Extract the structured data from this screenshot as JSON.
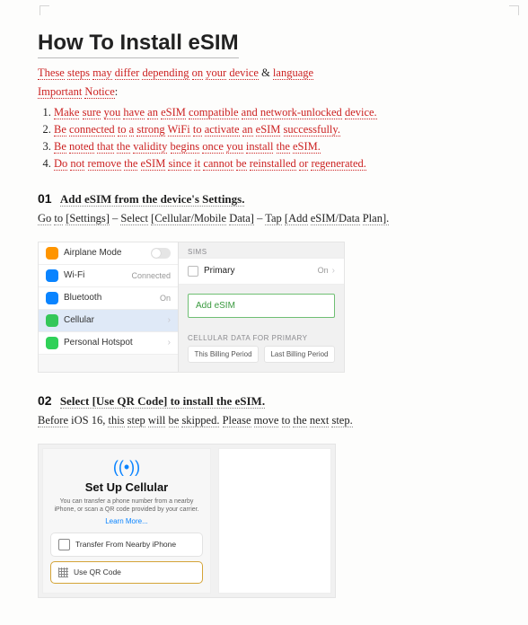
{
  "title": "How To Install eSIM",
  "intro_parts": {
    "p1": "These",
    "p2": "steps",
    "p3": "may",
    "p4": "differ",
    "p5": "depending",
    "p6": "on",
    "p7": "your",
    "p8": "device",
    "amp": "&",
    "p9": "language"
  },
  "important": {
    "label1": "Important",
    "label2": "Notice",
    "colon": ":"
  },
  "notice_items": [
    {
      "w": [
        "Make",
        "sure",
        "you",
        "have",
        "an",
        "eSIM",
        "compatible",
        "and",
        "network-unlocked",
        "device."
      ]
    },
    {
      "w": [
        "Be",
        "connected",
        "to",
        "a",
        "strong",
        "WiFi",
        "to",
        "activate",
        "an",
        "eSIM",
        "successfully."
      ]
    },
    {
      "w": [
        "Be",
        "noted",
        "that",
        "the",
        "validity",
        "begins",
        "once",
        "you",
        "install",
        "the",
        "eSIM."
      ]
    },
    {
      "w": [
        "Do",
        "not",
        "remove",
        "the",
        "eSIM",
        "since",
        "it",
        "cannot",
        "be",
        "reinstalled",
        "or",
        "regenerated."
      ]
    }
  ],
  "step1": {
    "num": "01",
    "title_words": [
      "Add",
      "eSIM",
      "from",
      "the",
      "device's",
      "Settings."
    ],
    "instr": {
      "go": "Go",
      "to": "to",
      "settings": "[Settings]",
      "dash": "–",
      "select": "Select",
      "cell": "[Cellular/Mobile",
      "data": "Data]",
      "tap": "Tap",
      "addplan": "[Add",
      "esim": "eSIM/Data",
      "plan": "Plan]."
    }
  },
  "settings_rows": {
    "airplane": "Airplane Mode",
    "wifi": "Wi-Fi",
    "wifi_val": "Connected",
    "bluetooth": "Bluetooth",
    "bt_val": "On",
    "cellular": "Cellular",
    "hotspot": "Personal Hotspot"
  },
  "sims_panel": {
    "sims_label": "SIMs",
    "primary": "Primary",
    "primary_on": "On",
    "add_esim": "Add eSIM",
    "cd_label": "CELLULAR DATA FOR PRIMARY",
    "tab1": "This Billing Period",
    "tab2": "Last Billing Period"
  },
  "step2": {
    "num": "02",
    "title_words": [
      "Select",
      "[Use",
      "QR",
      "Code]",
      "to",
      "install",
      "the",
      "eSIM."
    ],
    "instr": {
      "before": "Before",
      "ios": "iOS 16,",
      "this": "this",
      "step": "step",
      "will": "will",
      "be": "be",
      "skipped": "skipped.",
      "please": "Please",
      "move": "move",
      "to": "to",
      "the": "the",
      "next": "next",
      "nstep": "step."
    }
  },
  "setup_card": {
    "title": "Set Up Cellular",
    "desc": "You can transfer a phone number from a nearby iPhone, or scan a QR code provided by your carrier.",
    "learn": "Learn More...",
    "btn1": "Transfer From Nearby iPhone",
    "btn2": "Use QR Code"
  }
}
